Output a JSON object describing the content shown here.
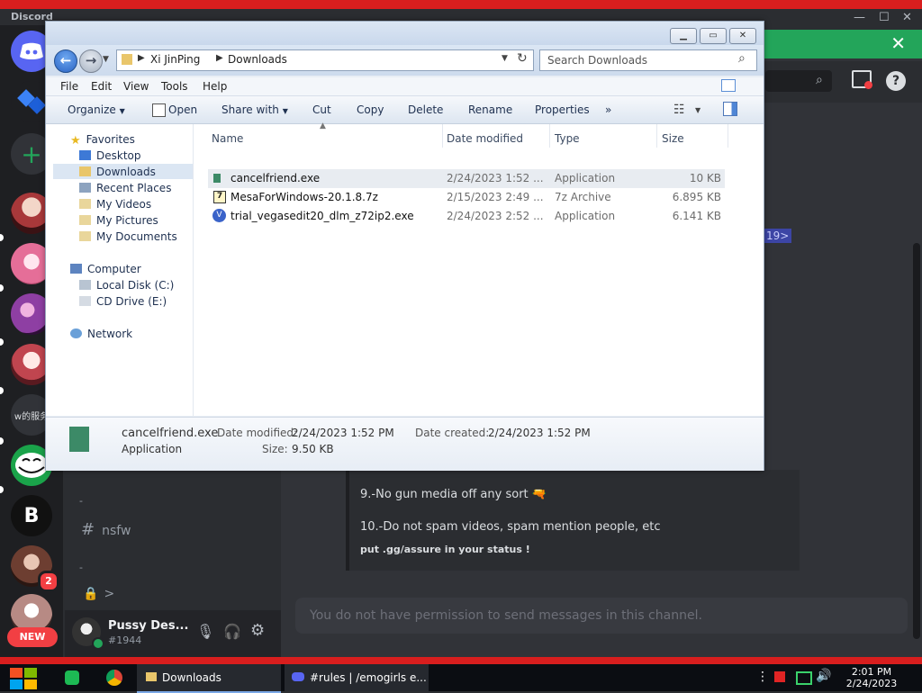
{
  "discord": {
    "app_title": "Discord",
    "servers": [
      {
        "name": "discord-home",
        "label": ""
      },
      {
        "name": "server-blue-app",
        "label": ""
      },
      {
        "name": "add-server",
        "label": "+"
      },
      {
        "name": "server-avatar-1",
        "label": ""
      },
      {
        "name": "server-avatar-2",
        "label": ""
      },
      {
        "name": "server-avatar-3",
        "label": ""
      },
      {
        "name": "server-avatar-4",
        "label": ""
      },
      {
        "name": "server-text",
        "label": "w的服务"
      },
      {
        "name": "server-trollface",
        "label": ""
      },
      {
        "name": "server-bitcoin",
        "label": "B"
      },
      {
        "name": "server-avatar-5",
        "label": ""
      },
      {
        "name": "server-avatar-6",
        "label": ""
      }
    ],
    "server_badge": "2",
    "new_badge": "NEW",
    "channels": {
      "category_1": "-",
      "nsfw": "nsfw",
      "category_2": "-",
      "locked": ">"
    },
    "user": {
      "name": "Pussy Des...",
      "tag": "#1944"
    },
    "rules": {
      "rule9": "9.-No gun media off any sort",
      "rule10": "10.-Do not spam videos, spam mention people, etc",
      "note": "put .gg/assure in your status !"
    },
    "mention_tag": "19>",
    "message_placeholder": "You do not have permission to send messages in this channel."
  },
  "explorer": {
    "breadcrumb": [
      "Xi JinPing",
      "Downloads"
    ],
    "search_placeholder": "Search Downloads",
    "menu": [
      "File",
      "Edit",
      "View",
      "Tools",
      "Help"
    ],
    "commands": [
      "Organize",
      "Open",
      "Share with",
      "Cut",
      "Copy",
      "Delete",
      "Rename",
      "Properties",
      "»"
    ],
    "nav": {
      "favorites": "Favorites",
      "favorites_items": [
        "Desktop",
        "Downloads",
        "Recent Places",
        "My Videos",
        "My Pictures",
        "My Documents"
      ],
      "computer": "Computer",
      "computer_items": [
        "Local Disk (C:)",
        "CD Drive (E:)"
      ],
      "network": "Network"
    },
    "columns": [
      "Name",
      "Date modified",
      "Type",
      "Size"
    ],
    "files": [
      {
        "name": "cancelfriend.exe",
        "date": "2/24/2023 1:52 ...",
        "type": "Application",
        "size": "10 KB"
      },
      {
        "name": "MesaForWindows-20.1.8.7z",
        "date": "2/15/2023 2:49 ...",
        "type": "7z Archive",
        "size": "6.895 KB"
      },
      {
        "name": "trial_vegasedit20_dlm_z72ip2.exe",
        "date": "2/24/2023 2:52 ...",
        "type": "Application",
        "size": "6.141 KB"
      }
    ],
    "details": {
      "file_name": "cancelfriend.exe",
      "file_type": "Application",
      "modified_label": "Date modified:",
      "modified_value": "2/24/2023 1:52 PM",
      "created_label": "Date created:",
      "created_value": "2/24/2023 1:52 PM",
      "size_label": "Size:",
      "size_value": "9.50 KB"
    }
  },
  "taskbar": {
    "downloads_label": "Downloads",
    "discord_label": "#rules | /emogirls e...",
    "time": "2:01 PM",
    "date": "2/24/2023"
  },
  "colors": {
    "discord_green": "#23a55a",
    "discord_red": "#f23f43",
    "explorer_blue": "#3a76d1"
  }
}
